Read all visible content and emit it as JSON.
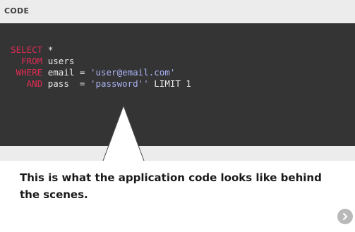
{
  "header": {
    "label": "CODE"
  },
  "code": {
    "lines": [
      {
        "indent": "  ",
        "keyword": "SELECT",
        "parts": [
          {
            "text": " *",
            "type": "plain"
          }
        ]
      },
      {
        "indent": "    ",
        "keyword": "FROM",
        "parts": [
          {
            "text": " users",
            "type": "plain"
          }
        ]
      },
      {
        "indent": "   ",
        "keyword": "WHERE",
        "parts": [
          {
            "text": " email = ",
            "type": "plain"
          },
          {
            "text": "'user@email.com'",
            "type": "string"
          }
        ]
      },
      {
        "indent": "     ",
        "keyword": "AND",
        "parts": [
          {
            "text": " pass  = ",
            "type": "plain"
          },
          {
            "text": "'password''",
            "type": "string"
          },
          {
            "text": " LIMIT 1",
            "type": "plain"
          }
        ]
      }
    ]
  },
  "caption": "This is what the application code looks like behind the scenes.",
  "colors": {
    "keyword": "#e02c54",
    "string": "#a9b2f2",
    "code_text": "#ececec",
    "code_bg": "#343434",
    "header_bg": "#ececec"
  },
  "next_button": {
    "icon": "chevron-right-icon"
  }
}
